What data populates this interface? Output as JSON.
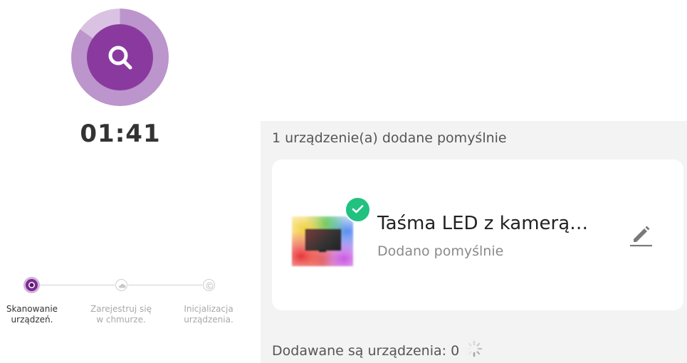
{
  "scan": {
    "timer": "01:41",
    "accent_color": "#8a3a9e",
    "ring_color": "#bb95cb",
    "icon": "search-icon"
  },
  "steps": [
    {
      "label": "Skanowanie urządzeń.",
      "state": "active",
      "icon": "radio-dot-icon"
    },
    {
      "label": "Zarejestruj się w chmurze.",
      "state": "pending",
      "icon": "cloud-icon"
    },
    {
      "label": "Inicjalizacja urządzenia.",
      "state": "pending",
      "icon": "copyright-c-icon"
    }
  ],
  "result": {
    "header": "1 urządzenie(a) dodane pomyślnie",
    "device": {
      "name": "Taśma LED z kamerą…",
      "status": "Dodano pomyślnie",
      "badge_color": "#21c17f",
      "thumbnail": "led-tv-strip-thumbnail",
      "edit_icon": "pencil-icon"
    },
    "adding": "Dodawane są urządzenia: 0",
    "adding_icon": "loading-spinner-icon"
  }
}
